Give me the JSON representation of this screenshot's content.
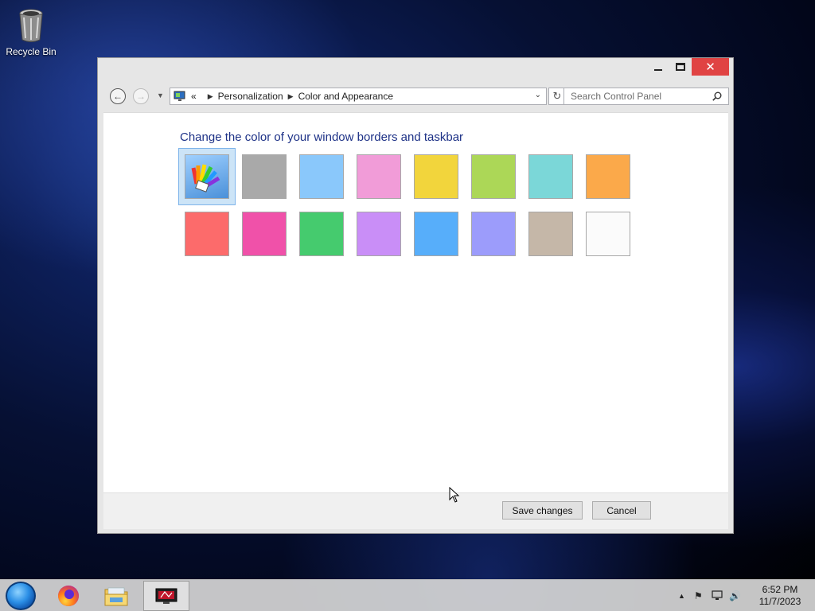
{
  "desktop": {
    "recycle_bin_label": "Recycle Bin"
  },
  "window": {
    "controls": {
      "minimize": "–",
      "maximize": "□",
      "close": "✕"
    },
    "address": {
      "overflow": "«",
      "crumbs": [
        "Personalization",
        "Color and Appearance"
      ]
    },
    "search_placeholder": "Search Control Panel",
    "heading": "Change the color of your window borders and taskbar",
    "swatches": [
      {
        "color": "#4a90d9",
        "type": "automatic"
      },
      {
        "color": "#a9a9a9"
      },
      {
        "color": "#8ac8fb"
      },
      {
        "color": "#f19cd8"
      },
      {
        "color": "#f2d53c"
      },
      {
        "color": "#acd757"
      },
      {
        "color": "#7bd7d8"
      },
      {
        "color": "#fba94a"
      },
      {
        "color": "#fc6b6b"
      },
      {
        "color": "#f051a9"
      },
      {
        "color": "#45cb6e"
      },
      {
        "color": "#c98ef7"
      },
      {
        "color": "#57aefa"
      },
      {
        "color": "#9c9cfb"
      },
      {
        "color": "#c5b7a8"
      },
      {
        "color": "#fbfbfb"
      }
    ],
    "buttons": {
      "save": "Save changes",
      "cancel": "Cancel"
    }
  },
  "taskbar": {
    "time": "6:52 PM",
    "date": "11/7/2023"
  }
}
